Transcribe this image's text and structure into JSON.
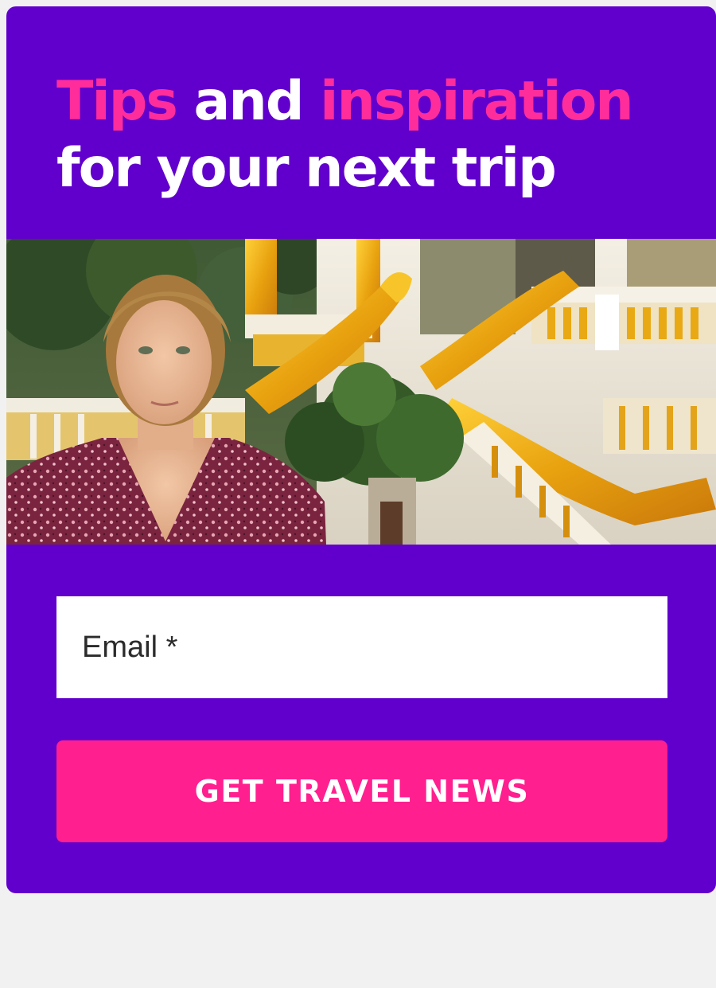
{
  "signup": {
    "headline": {
      "word1": "Tips",
      "word2": " and ",
      "word3": "inspiration",
      "line2": "for your next trip"
    },
    "email": {
      "placeholder": "Email *",
      "value": ""
    },
    "submit_label": "GET TRAVEL NEWS"
  },
  "colors": {
    "card_background": "#6100cc",
    "accent_pink": "#ff2d9b",
    "button_pink": "#ff1f8e",
    "page_background": "#f2f1f2"
  },
  "hero_image": {
    "description_icon": "temple-photo-with-presenter"
  }
}
